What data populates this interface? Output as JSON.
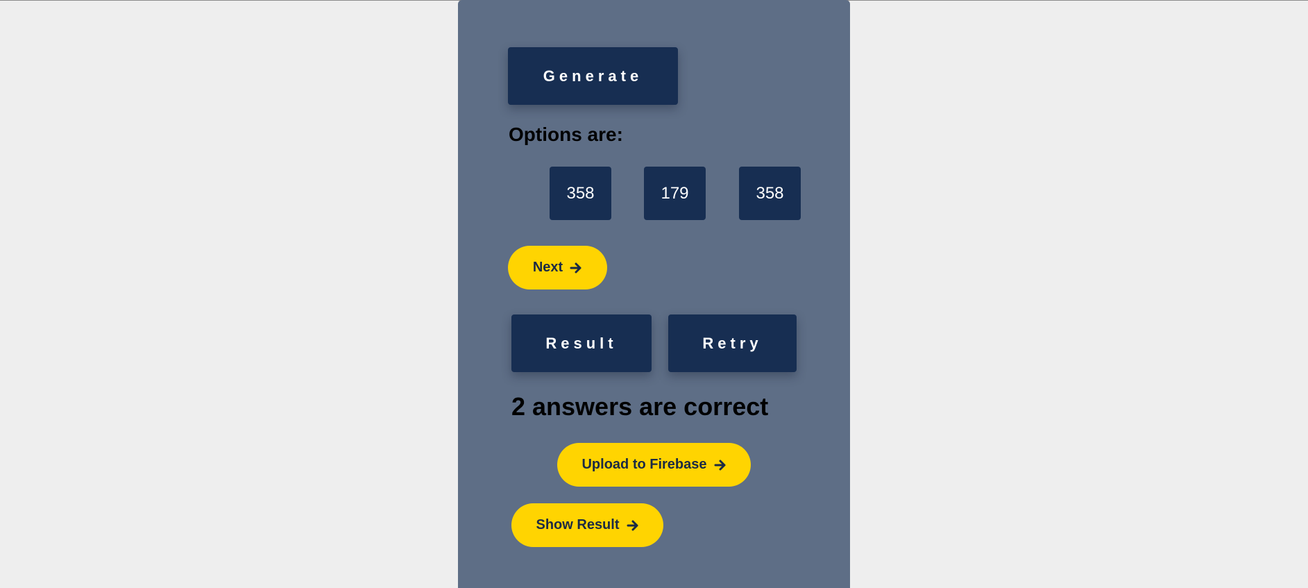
{
  "quiz": {
    "generate_label": "Generate",
    "options_label": "Options are:",
    "options": [
      "358",
      "179",
      "358"
    ],
    "next_label": "Next",
    "result_label": "Result",
    "retry_label": "Retry",
    "correct_text": "2 answers are correct",
    "upload_label": "Upload to Firebase",
    "show_result_label": "Show Result"
  },
  "icons": {
    "next": "arrow-right-icon",
    "upload": "arrow-right-icon",
    "show_result": "arrow-right-icon"
  },
  "colors": {
    "page_background": "#eeeeee",
    "panel_background": "#5e6e86",
    "dark_button": "#172e52",
    "accent_yellow": "#ffd401",
    "pill_text": "#1b2a44"
  }
}
